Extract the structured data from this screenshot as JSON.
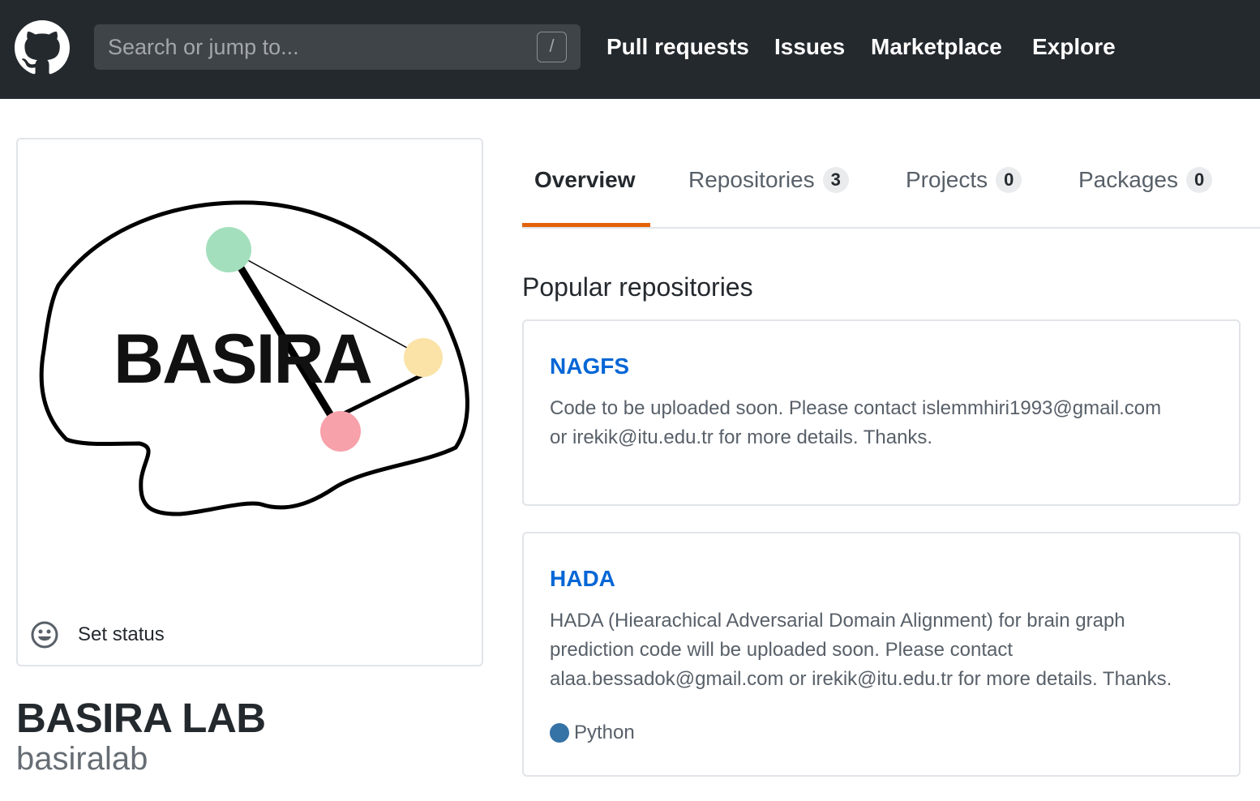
{
  "header": {
    "search_placeholder": "Search or jump to...",
    "search_shortcut": "/",
    "nav": [
      "Pull requests",
      "Issues",
      "Marketplace",
      "Explore"
    ]
  },
  "profile": {
    "avatar_text": "BASIRA",
    "status_label": "Set status",
    "full_name": "BASIRA LAB",
    "username": "basiralab"
  },
  "tabs": [
    {
      "label": "Overview",
      "count": null,
      "selected": true
    },
    {
      "label": "Repositories",
      "count": "3"
    },
    {
      "label": "Projects",
      "count": "0"
    },
    {
      "label": "Packages",
      "count": "0"
    }
  ],
  "popular": {
    "title": "Popular repositories",
    "repos": [
      {
        "name": "NAGFS",
        "description_lines": [
          "Code to be uploaded soon. Please contact islemmhiri1993@gmail.com",
          "or irekik@itu.edu.tr for more details. Thanks."
        ]
      },
      {
        "name": "HADA",
        "description_lines": [
          "HADA (Hiearachical Adversarial Domain Alignment) for brain graph",
          "prediction code will be uploaded soon. Please contact",
          "alaa.bessadok@gmail.com or irekik@itu.edu.tr for more details. Thanks."
        ],
        "language": "Python",
        "language_color": "#3572A5"
      }
    ]
  },
  "colors": {
    "header_bg": "#24292e",
    "link": "#0366d6",
    "tab_accent": "#e36209",
    "node_green": "#a3dfbc",
    "node_yellow": "#fbe3a8",
    "node_pink": "#f7a1ab"
  }
}
